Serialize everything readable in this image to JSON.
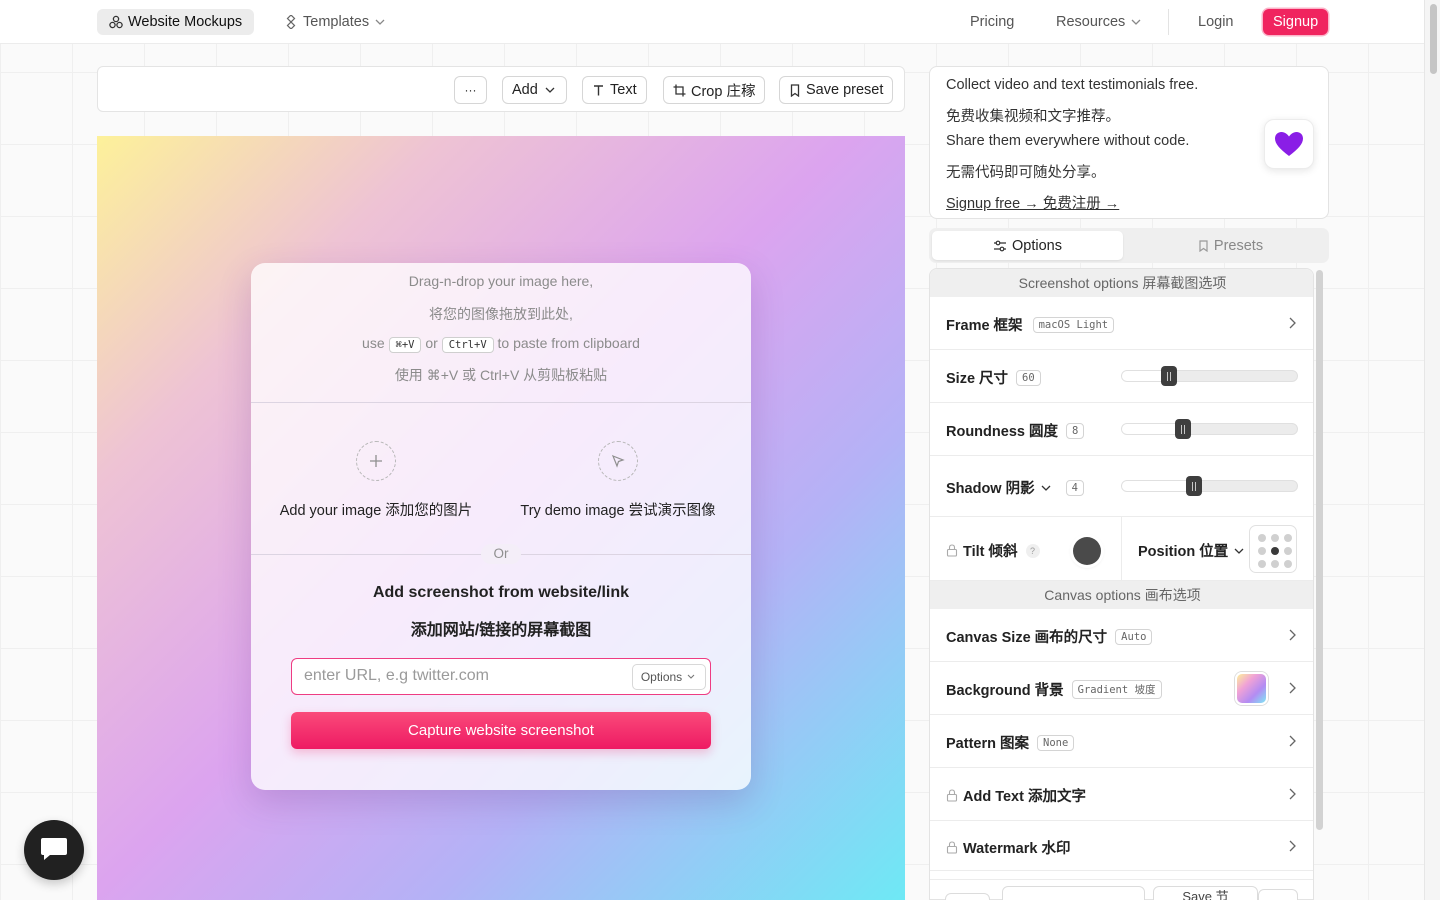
{
  "nav": {
    "website_mockups": "Website Mockups",
    "templates": "Templates",
    "pricing": "Pricing",
    "resources": "Resources",
    "login": "Login",
    "signup": "Signup"
  },
  "toolbar": {
    "more": "···",
    "add": "Add",
    "text": "Text",
    "crop": "Crop 庄稼",
    "save_preset": "Save preset"
  },
  "drop": {
    "line1": "Drag-n-drop your image here,",
    "line2": "将您的图像拖放到此处,",
    "paste_use": "use",
    "paste_key_mac": "⌘+V",
    "paste_or": "or",
    "paste_key_win": "Ctrl+V",
    "paste_rest": "to paste from clipboard",
    "line4": "使用 ⌘+V 或 Ctrl+V 从剪贴板粘贴",
    "add_image": "Add your image 添加您的图片",
    "demo_image": "Try demo image 尝试演示图像",
    "or": "Or",
    "screenshot_title": "Add screenshot from website/link",
    "screenshot_title_cn": "添加网站/链接的屏幕截图",
    "url_placeholder": "enter URL, e.g twitter.com",
    "url_options": "Options",
    "capture": "Capture website screenshot"
  },
  "promo": {
    "line1": "Collect video and text testimonials free.",
    "line2": "免费收集视频和文字推荐。",
    "line3": "Share them everywhere without code.",
    "line4": "无需代码即可随处分享。",
    "link": "Signup free → 免费注册 →"
  },
  "tabs": {
    "options": "Options",
    "presets": "Presets"
  },
  "screenshot_options": {
    "header": "Screenshot options 屏幕截图选项",
    "frame_label": "Frame 框架",
    "frame_value": "macOS Light",
    "size_label": "Size 尺寸",
    "size_value": "60",
    "size_level": 0.27,
    "roundness_label": "Roundness 圆度",
    "roundness_value": "8",
    "roundness_level": 0.35,
    "shadow_label": "Shadow 阴影",
    "shadow_value": "4",
    "shadow_level": 0.41,
    "tilt_label": "Tilt 倾斜",
    "tilt_help": "?",
    "position_label": "Position 位置"
  },
  "canvas_options": {
    "header": "Canvas options 画布选项",
    "canvas_size_label": "Canvas Size 画布的尺寸",
    "canvas_size_value": "Auto",
    "background_label": "Background 背景",
    "background_value": "Gradient 坡度",
    "pattern_label": "Pattern 图案",
    "pattern_value": "None",
    "add_text_label": "Add Text 添加文字",
    "watermark_label": "Watermark 水印"
  },
  "bottom": {
    "save": "Save 节"
  },
  "colors": {
    "accent": "#f0245f",
    "heart": "#8a1ee6"
  }
}
